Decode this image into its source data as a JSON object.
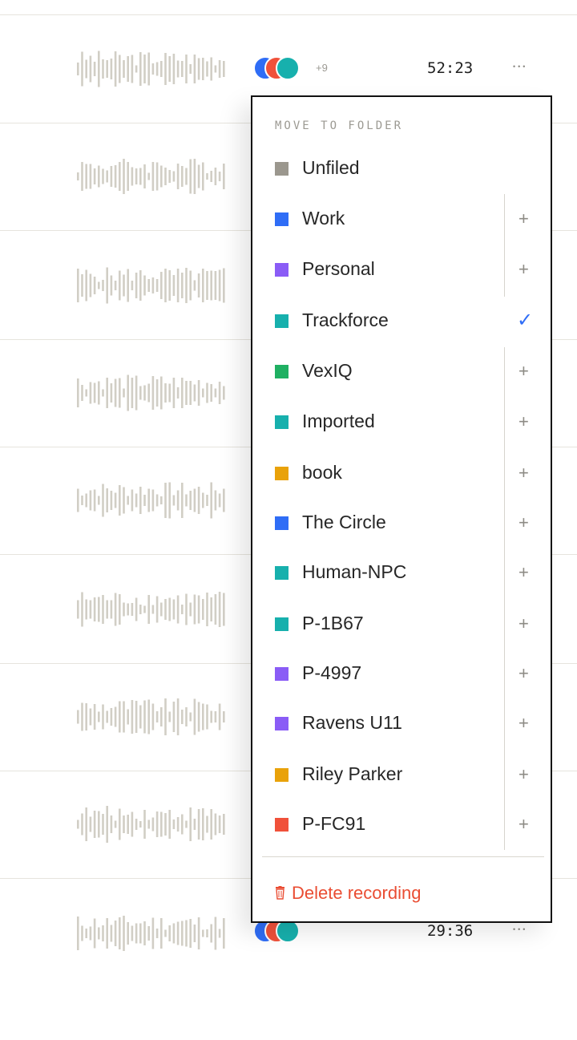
{
  "recordings": [
    {
      "duration": "52:23",
      "avatar_more": "+9"
    },
    {
      "duration": ""
    },
    {
      "duration": ""
    },
    {
      "duration": ""
    },
    {
      "duration": ""
    },
    {
      "duration": ""
    },
    {
      "duration": ""
    },
    {
      "duration": ""
    },
    {
      "duration": "29:36",
      "avatar_more": ""
    }
  ],
  "menu": {
    "title": "MOVE TO FOLDER",
    "folders": [
      {
        "name": "Unfiled",
        "color": "#9b978e",
        "action": ""
      },
      {
        "name": "Work",
        "color": "#2f6df6",
        "action": "+"
      },
      {
        "name": "Personal",
        "color": "#8a5cf6",
        "action": "+"
      },
      {
        "name": "Trackforce",
        "color": "#17b0ad",
        "action": "✓"
      },
      {
        "name": "VexIQ",
        "color": "#1fb062",
        "action": "+"
      },
      {
        "name": "Imported",
        "color": "#17b0ad",
        "action": "+"
      },
      {
        "name": "book",
        "color": "#e9a20a",
        "action": "+"
      },
      {
        "name": "The Circle",
        "color": "#2f6df6",
        "action": "+"
      },
      {
        "name": "Human-NPC",
        "color": "#17b0ad",
        "action": "+"
      },
      {
        "name": "P-1B67",
        "color": "#17b0ad",
        "action": "+"
      },
      {
        "name": "P-4997",
        "color": "#8a5cf6",
        "action": "+"
      },
      {
        "name": "Ravens U11",
        "color": "#8a5cf6",
        "action": "+"
      },
      {
        "name": "Riley Parker",
        "color": "#e9a20a",
        "action": "+"
      },
      {
        "name": "P-FC91",
        "color": "#f0513a",
        "action": "+"
      }
    ],
    "delete_label": "Delete recording"
  }
}
